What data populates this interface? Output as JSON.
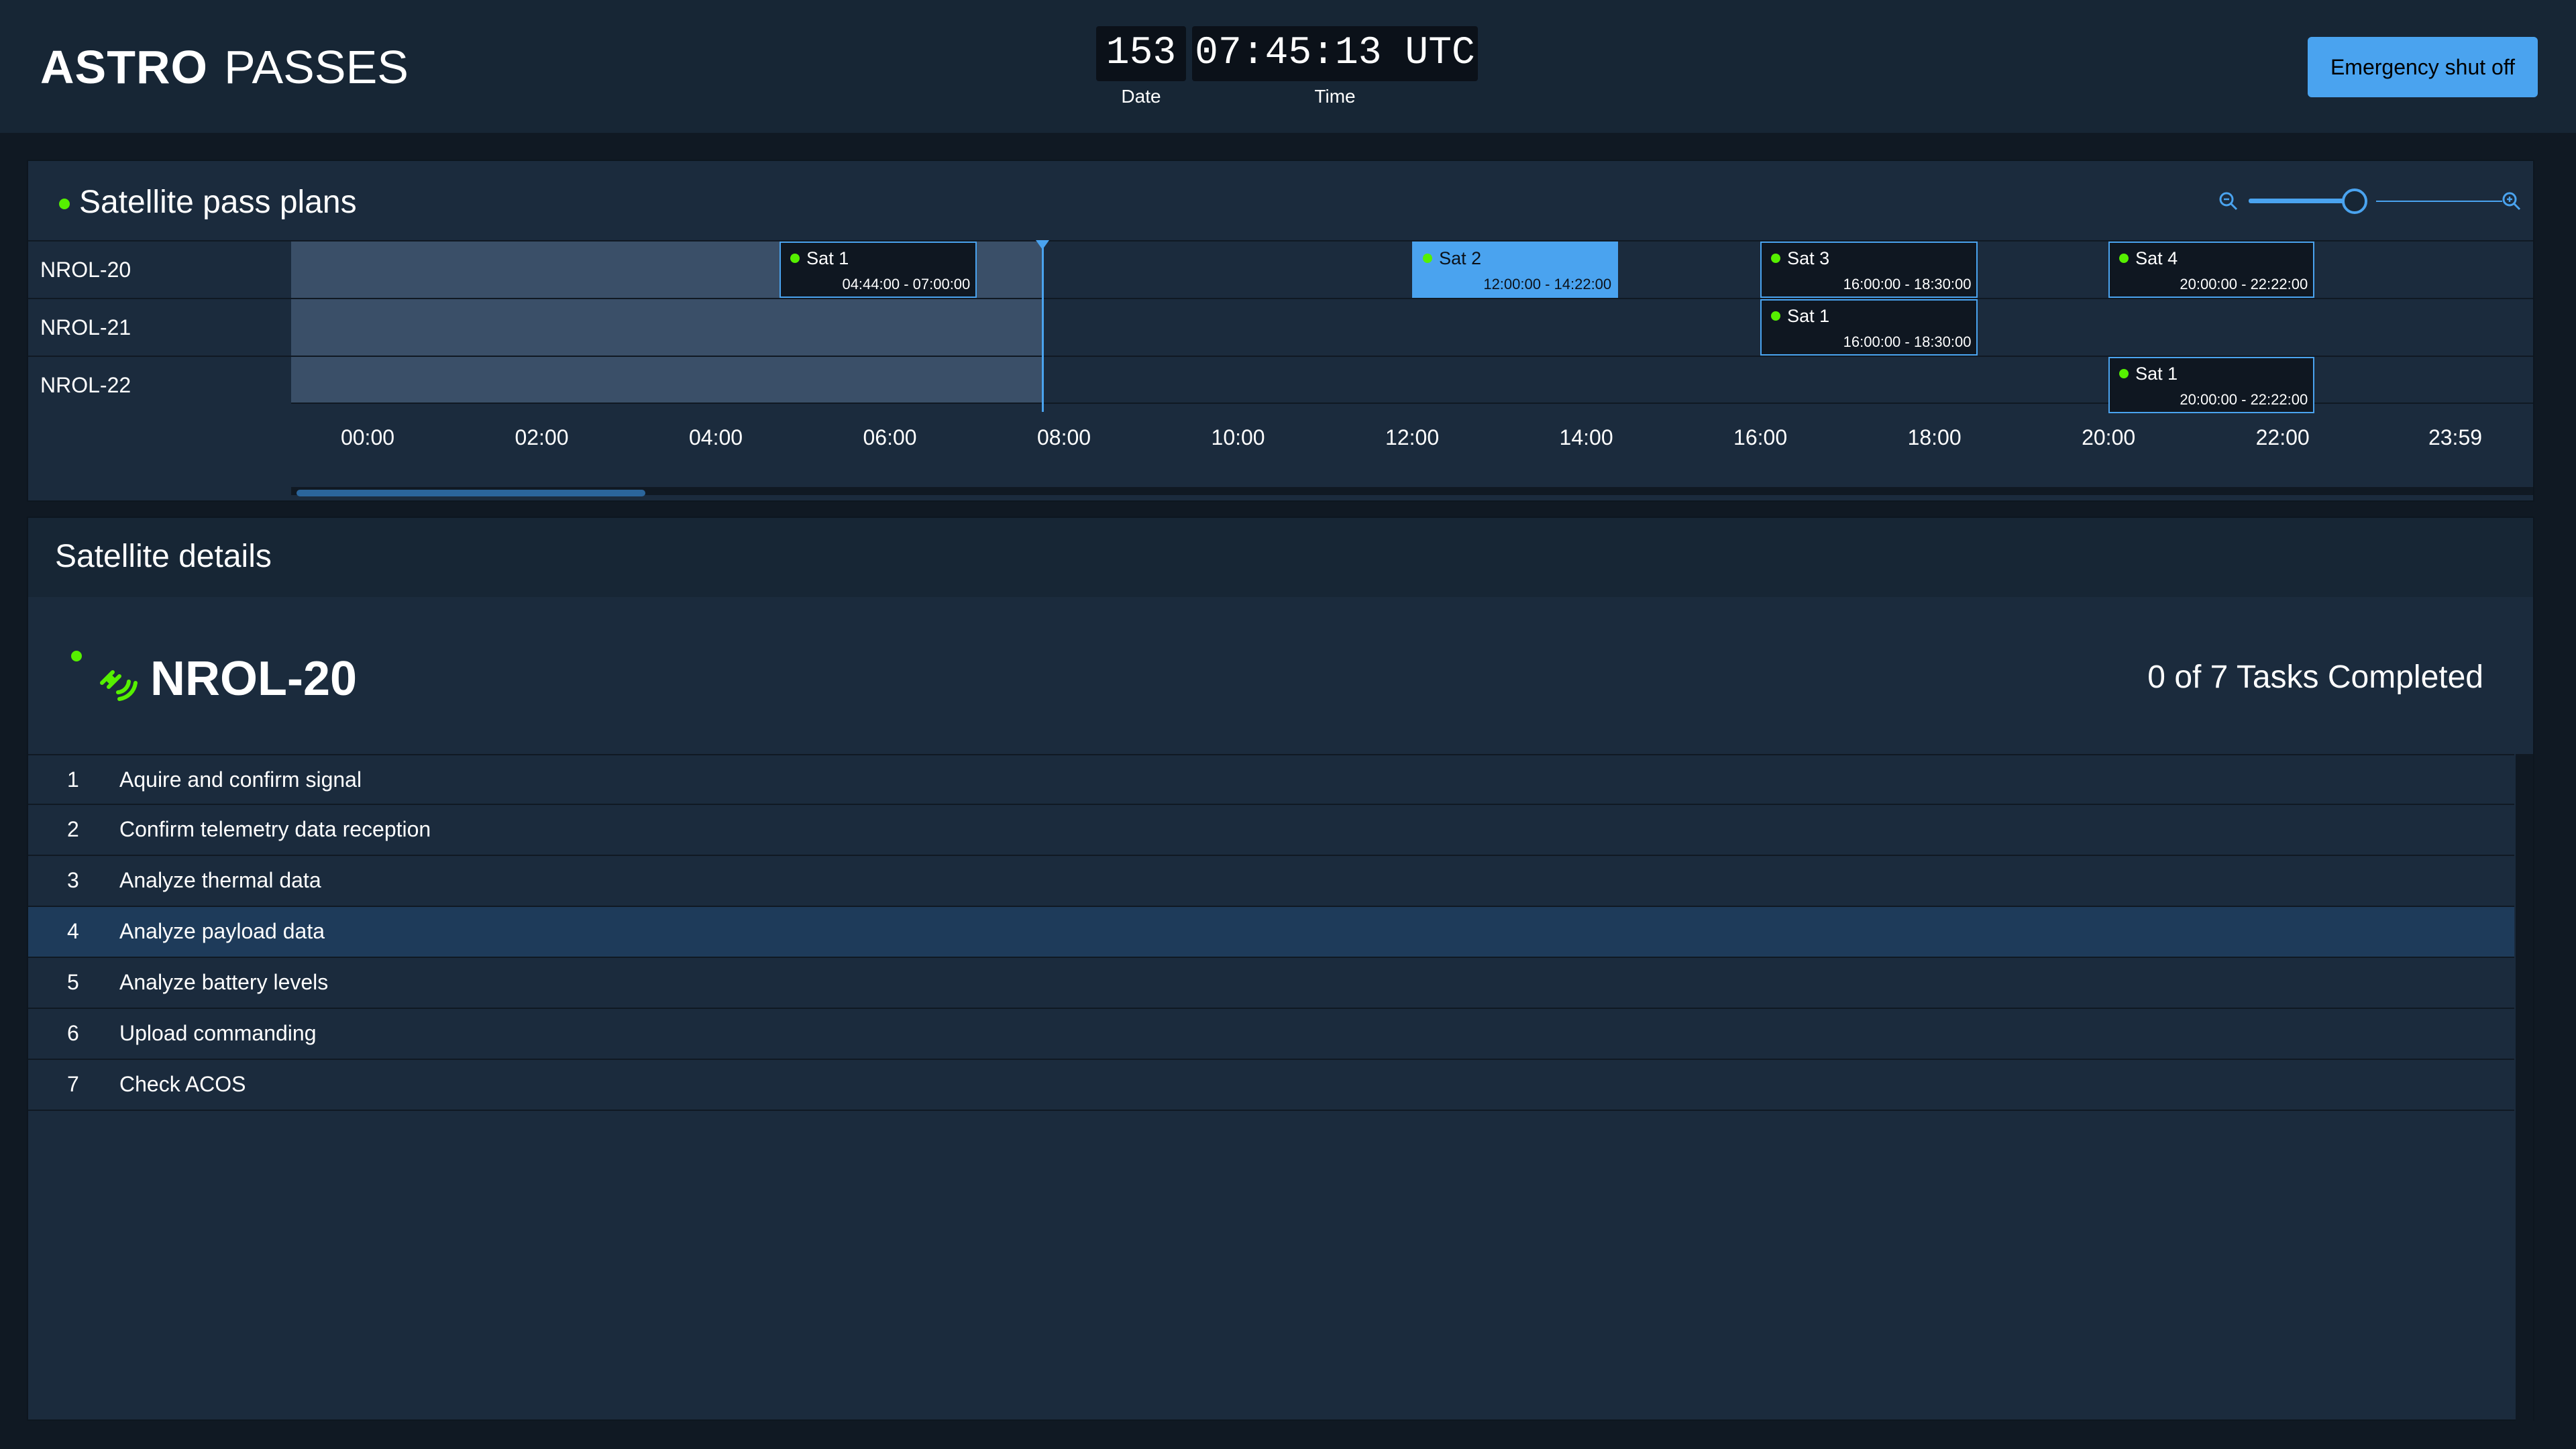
{
  "header": {
    "app_name_bold": "ASTRO",
    "app_name_light": "PASSES",
    "day_of_year": "153",
    "time": "07:45:13 UTC",
    "date_label": "Date",
    "time_label": "Time",
    "emergency_button": "Emergency shut off"
  },
  "passes_panel": {
    "title": "Satellite pass plans",
    "zoom_level": 0.47,
    "now": "07:45:13",
    "rows": [
      {
        "label": "NROL-20"
      },
      {
        "label": "NROL-21"
      },
      {
        "label": "NROL-22"
      }
    ],
    "passes": [
      {
        "row": "NROL-20",
        "name": "Sat 1",
        "time": "04:44:00 - 07:00:00",
        "start": "04:44:00",
        "end": "07:00:00",
        "selected": false
      },
      {
        "row": "NROL-20",
        "name": "Sat 2",
        "time": "12:00:00 - 14:22:00",
        "start": "12:00:00",
        "end": "14:22:00",
        "selected": true
      },
      {
        "row": "NROL-20",
        "name": "Sat 3",
        "time": "16:00:00 - 18:30:00",
        "start": "16:00:00",
        "end": "18:30:00",
        "selected": false
      },
      {
        "row": "NROL-20",
        "name": "Sat 4",
        "time": "20:00:00 - 22:22:00",
        "start": "20:00:00",
        "end": "22:22:00",
        "selected": false
      },
      {
        "row": "NROL-21",
        "name": "Sat 1",
        "time": "16:00:00 - 18:30:00",
        "start": "16:00:00",
        "end": "18:30:00",
        "selected": false
      },
      {
        "row": "NROL-22",
        "name": "Sat 1",
        "time": "20:00:00 - 22:22:00",
        "start": "20:00:00",
        "end": "22:22:00",
        "selected": false
      }
    ],
    "ticks": [
      "00:00",
      "02:00",
      "04:00",
      "06:00",
      "08:00",
      "10:00",
      "12:00",
      "14:00",
      "16:00",
      "18:00",
      "20:00",
      "22:00",
      "23:59"
    ]
  },
  "details_panel": {
    "title": "Satellite details",
    "satellite_name": "NROL-20",
    "tasks_summary": "0 of 7 Tasks Completed",
    "tasks": [
      {
        "num": "1",
        "name": "Aquire and confirm signal",
        "selected": false
      },
      {
        "num": "2",
        "name": "Confirm telemetry data reception",
        "selected": false
      },
      {
        "num": "3",
        "name": "Analyze thermal data",
        "selected": false
      },
      {
        "num": "4",
        "name": "Analyze payload data",
        "selected": true
      },
      {
        "num": "5",
        "name": "Analyze battery levels",
        "selected": false
      },
      {
        "num": "6",
        "name": "Upload commanding",
        "selected": false
      },
      {
        "num": "7",
        "name": "Check ACOS",
        "selected": false
      }
    ]
  },
  "colors": {
    "accent": "#4aa3ef",
    "status_ok": "#56f000",
    "background": "#101923",
    "panel": "#1b2b3d"
  }
}
